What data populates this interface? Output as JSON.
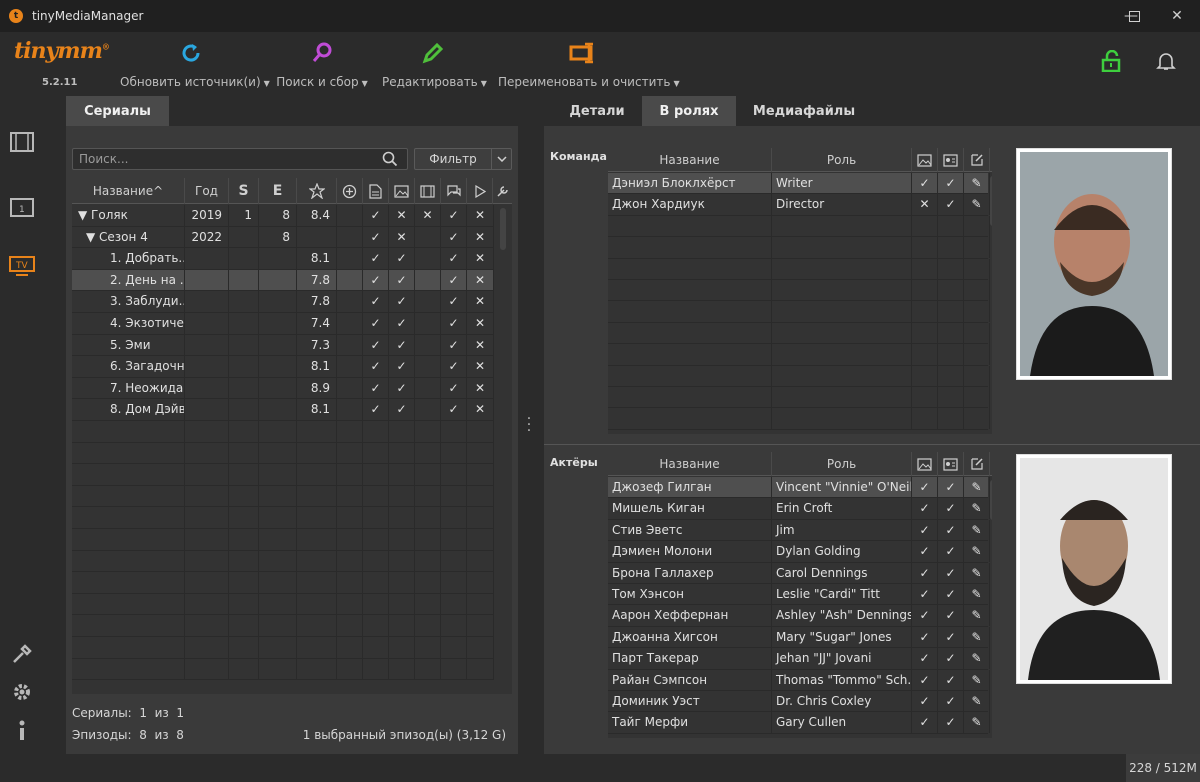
{
  "window": {
    "title": "tinyMediaManager",
    "minimize": "—",
    "maximize": "☐",
    "close": "✕"
  },
  "toolbar": {
    "logo": "tinymm",
    "logo_mark": "®",
    "version": "5.2.11",
    "update_label": "Обновить источник(и)",
    "search_label": "Поиск и сбор",
    "edit_label": "Редактировать",
    "rename_label": "Переименовать и очистить",
    "accent_update": "#2aa7e0",
    "accent_search": "#c04cd6",
    "accent_edit": "#4fbf3b",
    "accent_rename": "#e8831a"
  },
  "left": {
    "tab": "Сериалы",
    "search_placeholder": "Поиск...",
    "filter_label": "Фильтр",
    "columns": {
      "title": "Название^",
      "year": "Год",
      "s": "S",
      "e": "E"
    },
    "rows": [
      {
        "title": "▼ Голяк",
        "year": "2019",
        "s": "1",
        "e": "8",
        "rating": "8.4",
        "c1": "✓",
        "c2": "✕",
        "c3": "✕",
        "c4": "✓",
        "c5": "✕"
      },
      {
        "title": "▼ Сезон 4",
        "year": "2022",
        "s": "",
        "e": "8",
        "rating": "",
        "c1": "✓",
        "c2": "✕",
        "c3": "",
        "c4": "✓",
        "c5": "✕"
      },
      {
        "title": "1. Добрать...",
        "year": "",
        "s": "",
        "e": "",
        "rating": "8.1",
        "c1": "✓",
        "c2": "✓",
        "c3": "",
        "c4": "✓",
        "c5": "✕"
      },
      {
        "title": "2. День на ...",
        "year": "",
        "s": "",
        "e": "",
        "rating": "7.8",
        "c1": "✓",
        "c2": "✓",
        "c3": "",
        "c4": "✓",
        "c5": "✕"
      },
      {
        "title": "3. Заблуди...",
        "year": "",
        "s": "",
        "e": "",
        "rating": "7.8",
        "c1": "✓",
        "c2": "✓",
        "c3": "",
        "c4": "✓",
        "c5": "✕"
      },
      {
        "title": "4. Экзотиче...",
        "year": "",
        "s": "",
        "e": "",
        "rating": "7.4",
        "c1": "✓",
        "c2": "✓",
        "c3": "",
        "c4": "✓",
        "c5": "✕"
      },
      {
        "title": "5. Эми",
        "year": "",
        "s": "",
        "e": "",
        "rating": "7.3",
        "c1": "✓",
        "c2": "✓",
        "c3": "",
        "c4": "✓",
        "c5": "✕"
      },
      {
        "title": "6. Загадочн...",
        "year": "",
        "s": "",
        "e": "",
        "rating": "8.1",
        "c1": "✓",
        "c2": "✓",
        "c3": "",
        "c4": "✓",
        "c5": "✕"
      },
      {
        "title": "7. Неожида...",
        "year": "",
        "s": "",
        "e": "",
        "rating": "8.9",
        "c1": "✓",
        "c2": "✓",
        "c3": "",
        "c4": "✓",
        "c5": "✕"
      },
      {
        "title": "8. Дом Дэйви",
        "year": "",
        "s": "",
        "e": "",
        "rating": "8.1",
        "c1": "✓",
        "c2": "✓",
        "c3": "",
        "c4": "✓",
        "c5": "✕"
      }
    ],
    "status_series_label": "Сериалы:",
    "status_series": "1  из  1",
    "status_episodes_label": "Эпизоды:",
    "status_episodes": "8  из  8",
    "status_selected": "1 выбранный эпизод(ы) (3,12 G)"
  },
  "right": {
    "tabs": [
      "Детали",
      "В ролях",
      "Медиафайлы"
    ],
    "crew_label": "Команда",
    "actors_label": "Актёры",
    "col_name": "Название",
    "col_role": "Роль",
    "crew": [
      {
        "name": "Дэниэл Блоклхёрст",
        "role": "Writer",
        "c1": "✓",
        "c2": "✓",
        "c3": "✎"
      },
      {
        "name": "Джон Хардиук",
        "role": "Director",
        "c1": "✕",
        "c2": "✓",
        "c3": "✎"
      }
    ],
    "actors": [
      {
        "name": "Джозеф Гилган",
        "role": "Vincent \"Vinnie\" O'Neill",
        "c1": "✓",
        "c2": "✓",
        "c3": "✎"
      },
      {
        "name": "Мишель Киган",
        "role": "Erin Croft",
        "c1": "✓",
        "c2": "✓",
        "c3": "✎"
      },
      {
        "name": "Стив Эветс",
        "role": "Jim",
        "c1": "✓",
        "c2": "✓",
        "c3": "✎"
      },
      {
        "name": "Дэмиен Молони",
        "role": "Dylan Golding",
        "c1": "✓",
        "c2": "✓",
        "c3": "✎"
      },
      {
        "name": "Брона Галлахер",
        "role": "Carol Dennings",
        "c1": "✓",
        "c2": "✓",
        "c3": "✎"
      },
      {
        "name": "Том Хэнсон",
        "role": "Leslie \"Cardi\" Titt",
        "c1": "✓",
        "c2": "✓",
        "c3": "✎"
      },
      {
        "name": "Аарон Хеффернан",
        "role": "Ashley \"Ash\" Dennings",
        "c1": "✓",
        "c2": "✓",
        "c3": "✎"
      },
      {
        "name": "Джоанна Хигсон",
        "role": "Mary \"Sugar\" Jones",
        "c1": "✓",
        "c2": "✓",
        "c3": "✎"
      },
      {
        "name": "Парт Такерар",
        "role": "Jehan \"JJ\" Jovani",
        "c1": "✓",
        "c2": "✓",
        "c3": "✎"
      },
      {
        "name": "Райан Сэмпсон",
        "role": "Thomas \"Tommo\" Sch...",
        "c1": "✓",
        "c2": "✓",
        "c3": "✎"
      },
      {
        "name": "Доминик Уэст",
        "role": "Dr. Chris Coxley",
        "c1": "✓",
        "c2": "✓",
        "c3": "✎"
      },
      {
        "name": "Тайг Мерфи",
        "role": "Gary Cullen",
        "c1": "✓",
        "c2": "✓",
        "c3": "✎"
      }
    ]
  },
  "status": {
    "memory": "228 / 512M"
  }
}
